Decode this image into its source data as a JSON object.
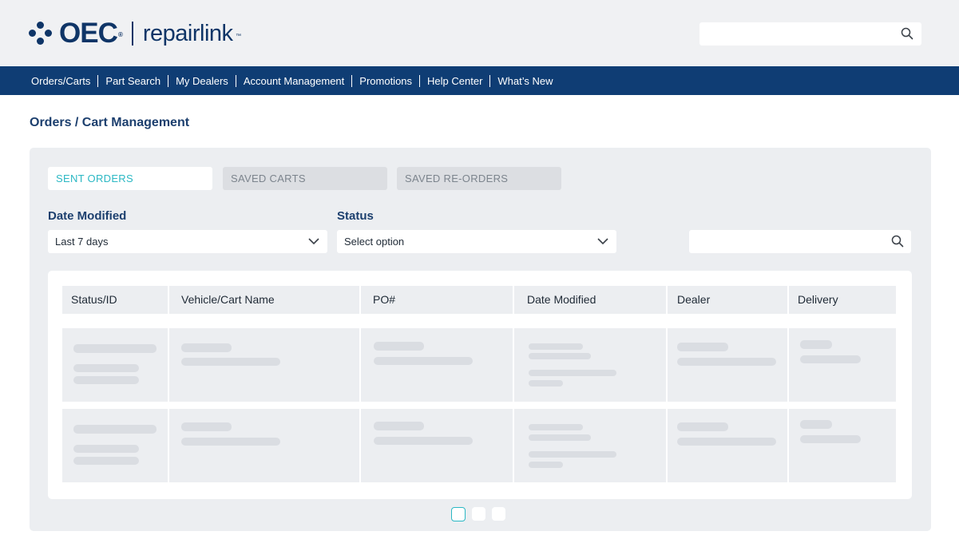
{
  "header": {
    "brand": "OEC",
    "brand_mark": "®",
    "product_prefix": "repair",
    "product_suffix": "link",
    "product_mark": "™",
    "search_placeholder": "",
    "search_icon": "search-icon"
  },
  "nav": {
    "items": [
      "Orders/Carts",
      "Part Search",
      "My Dealers",
      "Account Management",
      "Promotions",
      "Help Center",
      "What’s New"
    ]
  },
  "page": {
    "title": "Orders / Cart Management"
  },
  "tabs": [
    {
      "label": "SENT ORDERS",
      "active": true
    },
    {
      "label": "SAVED CARTS",
      "active": false
    },
    {
      "label": "SAVED RE-ORDERS",
      "active": false
    }
  ],
  "filters": {
    "date_label": "Date Modified",
    "date_value": "Last 7 days",
    "status_label": "Status",
    "status_value": "Select option",
    "search_placeholder": ""
  },
  "table": {
    "columns": [
      "Status/ID",
      "Vehicle/Cart Name",
      "PO#",
      "Date Modified",
      "Dealer",
      "Delivery"
    ],
    "rows_loading": 2
  },
  "pagination": {
    "pages": 3,
    "current": 1
  },
  "colors": {
    "brand_navy": "#0f3567",
    "nav_bg": "#0f3d74",
    "accent_teal": "#2bb8c4",
    "panel_bg": "#eceef1"
  }
}
